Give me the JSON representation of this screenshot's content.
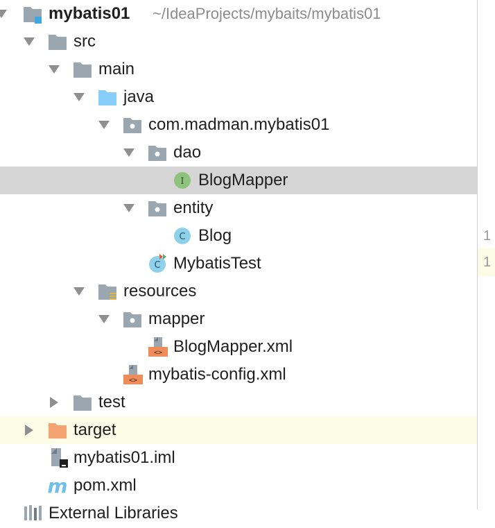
{
  "project_tree": {
    "root": {
      "name": "mybatis01",
      "path": "~/IdeaProjects/mybaits/mybatis01"
    },
    "items": [
      {
        "label": "src",
        "icon": "folder-icon"
      },
      {
        "label": "main",
        "icon": "folder-icon"
      },
      {
        "label": "java",
        "icon": "source-folder-icon"
      },
      {
        "label": "com.madman.mybatis01",
        "icon": "package-icon"
      },
      {
        "label": "dao",
        "icon": "package-icon"
      },
      {
        "label": "BlogMapper",
        "icon": "interface-icon"
      },
      {
        "label": "entity",
        "icon": "package-icon"
      },
      {
        "label": "Blog",
        "icon": "class-icon"
      },
      {
        "label": "MybatisTest",
        "icon": "test-class-icon"
      },
      {
        "label": "resources",
        "icon": "resources-folder-icon"
      },
      {
        "label": "mapper",
        "icon": "package-icon"
      },
      {
        "label": "BlogMapper.xml",
        "icon": "xml-file-icon"
      },
      {
        "label": "mybatis-config.xml",
        "icon": "xml-file-icon"
      },
      {
        "label": "test",
        "icon": "folder-icon"
      },
      {
        "label": "target",
        "icon": "excluded-folder-icon"
      },
      {
        "label": "mybatis01.iml",
        "icon": "iml-file-icon"
      },
      {
        "label": "pom.xml",
        "icon": "maven-icon"
      },
      {
        "label": "External Libraries",
        "icon": "libraries-icon"
      }
    ]
  },
  "gutter": {
    "lines": [
      "1",
      "1"
    ]
  },
  "colors": {
    "selected_row": "#d5d5d5",
    "excluded_row": "#fbfbe6",
    "folder_gray": "#9aa7b0",
    "source_blue": "#87cefa",
    "excluded_orange": "#f4a470",
    "interface_green": "#8ec27e",
    "class_blue": "#8fd0ea",
    "xml_orange": "#f08c5a"
  }
}
